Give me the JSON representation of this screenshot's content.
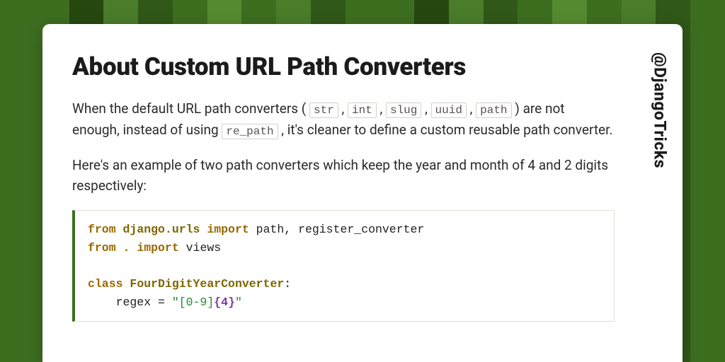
{
  "heading": "About Custom URL Path Converters",
  "handle": "@DjangoTricks",
  "para1": {
    "t1": "When the default URL path converters ( ",
    "c1": "str",
    "t2": " , ",
    "c2": "int",
    "t3": " , ",
    "c3": "slug",
    "t4": " , ",
    "c4": "uuid",
    "t5": " , ",
    "c5": "path",
    "t6": " ) are not enough, instead of using ",
    "c6": "re_path",
    "t7": " , it's cleaner to define a custom reusable path converter."
  },
  "para2": "Here's an example of two path converters which keep the year and month of 4 and 2 digits respectively:",
  "code": {
    "l1_kw1": "from",
    "l1_ns": " django.urls ",
    "l1_kw2": "import",
    "l1_rest": " path, register_converter",
    "l2_kw1": "from",
    "l2_ns": " . ",
    "l2_kw2": "import",
    "l2_rest": " views",
    "l3_kw": "class",
    "l3_cls": " FourDigitYearConverter",
    "l3_colon": ":",
    "l4_indent": "    regex = ",
    "l4_s1": "\"[0-9]",
    "l4_b": "{4}",
    "l4_s2": "\""
  }
}
